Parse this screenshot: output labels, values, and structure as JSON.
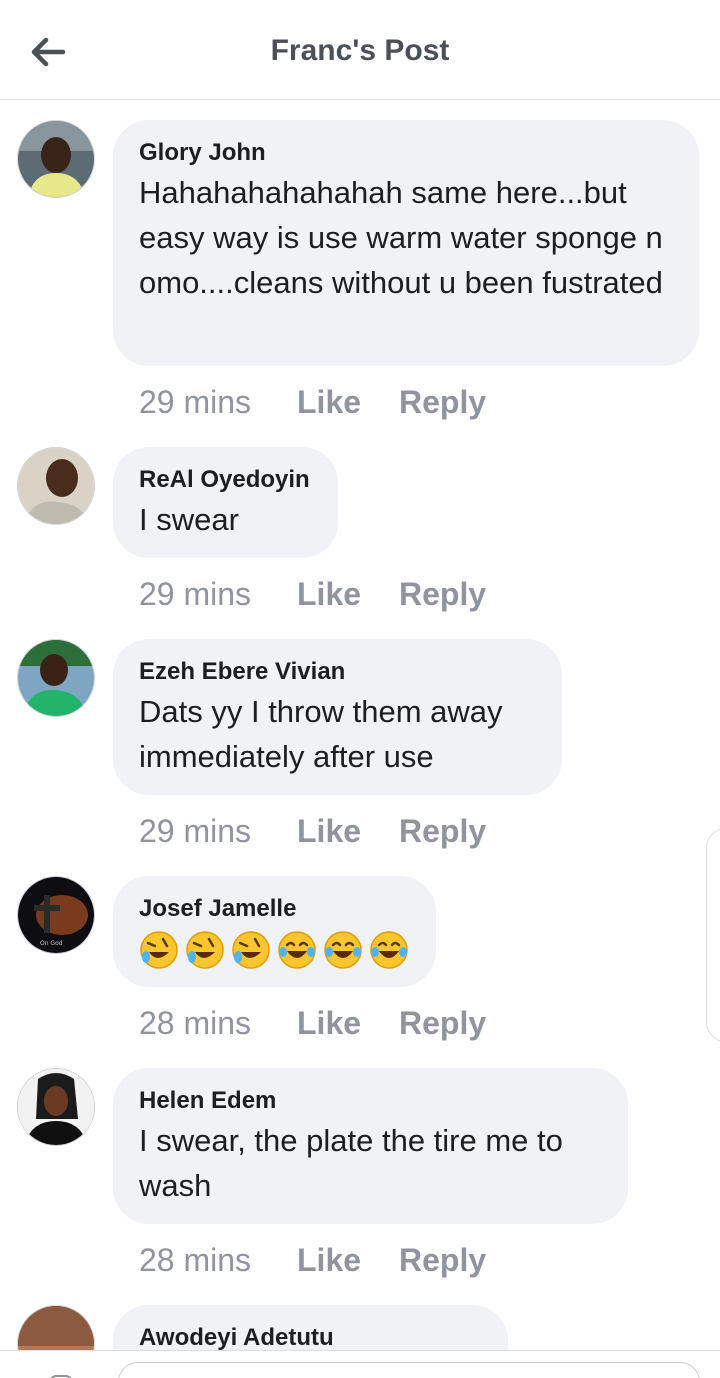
{
  "header": {
    "title": "Franc's Post",
    "back_icon": "arrow-left-icon"
  },
  "actions": {
    "like": "Like",
    "reply": "Reply"
  },
  "comments": [
    {
      "author": "Glory John",
      "text": "Hahahahahahahah same here...but easy way is use warm water sponge n omo....cleans without u been fustrated",
      "time": "29 mins"
    },
    {
      "author": "ReAl Oyedoyin",
      "text": "I swear",
      "time": "29 mins"
    },
    {
      "author": "Ezeh Ebere Vivian",
      "text": "Dats yy I throw them away immediately after use",
      "time": "29 mins"
    },
    {
      "author": "Josef Jamelle",
      "emojis": [
        "rolling-laughing-emoji",
        "rolling-laughing-emoji",
        "rolling-laughing-emoji",
        "tears-of-joy-emoji",
        "tears-of-joy-emoji",
        "tears-of-joy-emoji"
      ],
      "avatar_caption": "On God",
      "time": "28 mins"
    },
    {
      "author": "Helen Edem",
      "text": "I swear, the plate the tire me to wash",
      "time": "28 mins"
    },
    {
      "author": "Awodeyi Adetutu"
    }
  ],
  "colors": {
    "bubble": "#f0f2f5",
    "meta": "#90949c",
    "title": "#4b4f56"
  }
}
